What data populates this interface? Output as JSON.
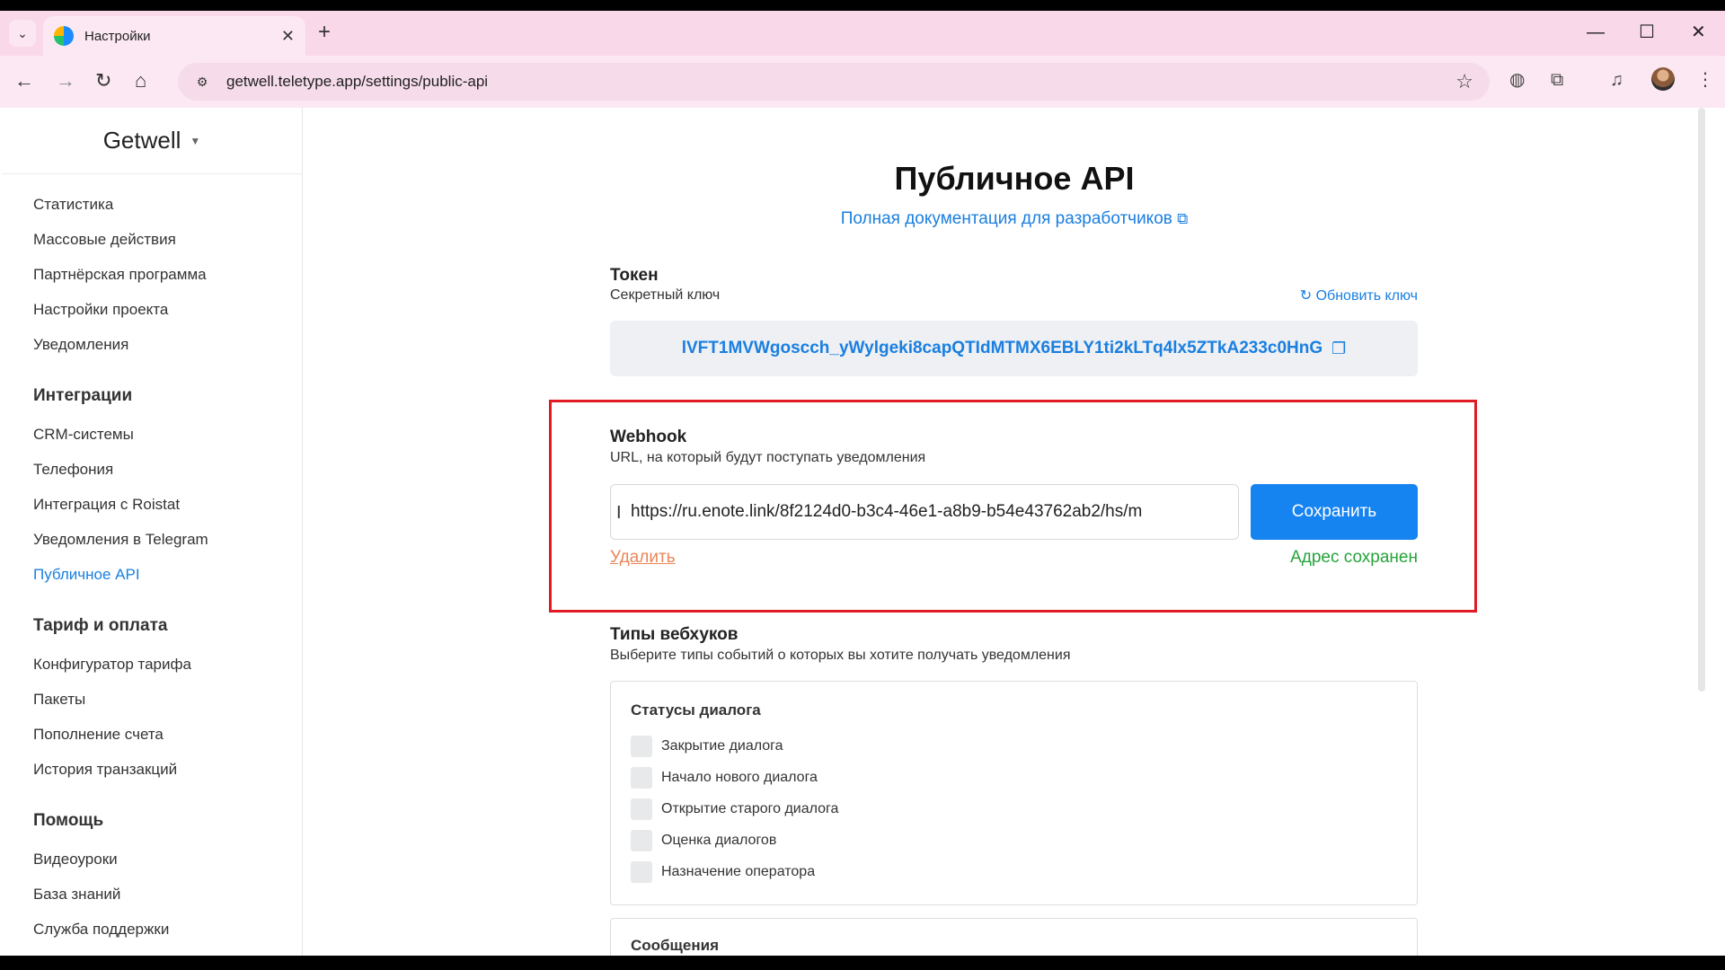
{
  "browser": {
    "tab_title": "Настройки",
    "tab_close": "✕",
    "new_tab": "+",
    "url": "getwell.teletype.app/settings/public-api",
    "window_controls": {
      "minimize": "—",
      "maximize": "☐",
      "close": "✕"
    }
  },
  "sidebar": {
    "brand": "Getwell",
    "items_top": [
      "Статистика",
      "Массовые действия",
      "Партнёрская программа",
      "Настройки проекта",
      "Уведомления"
    ],
    "section_integrations": "Интеграции",
    "items_integrations": [
      "CRM-системы",
      "Телефония",
      "Интеграция с Roistat",
      "Уведомления в Telegram",
      "Публичное API"
    ],
    "section_billing": "Тариф и оплата",
    "items_billing": [
      "Конфигуратор тарифа",
      "Пакеты",
      "Пополнение счета",
      "История транзакций"
    ],
    "section_help": "Помощь",
    "items_help": [
      "Видеоуроки",
      "База знаний",
      "Служба поддержки"
    ]
  },
  "main": {
    "title": "Публичное API",
    "doc_link": "Полная документация для разработчиков",
    "token": {
      "title": "Токен",
      "subtitle": "Секретный ключ",
      "refresh": "Обновить ключ",
      "value": "lVFT1MVWgoscch_yWylgeki8capQTIdMTMX6EBLY1ti2kLTq4lx5ZTkA233c0HnG"
    },
    "webhook": {
      "title": "Webhook",
      "subtitle": "URL, на который будут поступать уведомления",
      "url_value": "https://ru.enote.link/8f2124d0-b3c4-46e1-a8b9-b54e43762ab2/hs/m",
      "save_label": "Сохранить",
      "delete_label": "Удалить",
      "status": "Адрес сохранен"
    },
    "webhook_types": {
      "title": "Типы вебхуков",
      "subtitle": "Выберите типы событий о которых вы хотите получать уведомления",
      "dialog_statuses": {
        "title": "Статусы диалога",
        "options": [
          "Закрытие диалога",
          "Начало нового диалога",
          "Открытие старого диалога",
          "Оценка диалогов",
          "Назначение оператора"
        ]
      },
      "messages_title": "Сообщения"
    }
  },
  "colors": {
    "accent": "#1a7fe0",
    "button": "#1583f0",
    "danger": "#e8875a",
    "success": "#25a33a",
    "highlight": "#e01b24"
  }
}
